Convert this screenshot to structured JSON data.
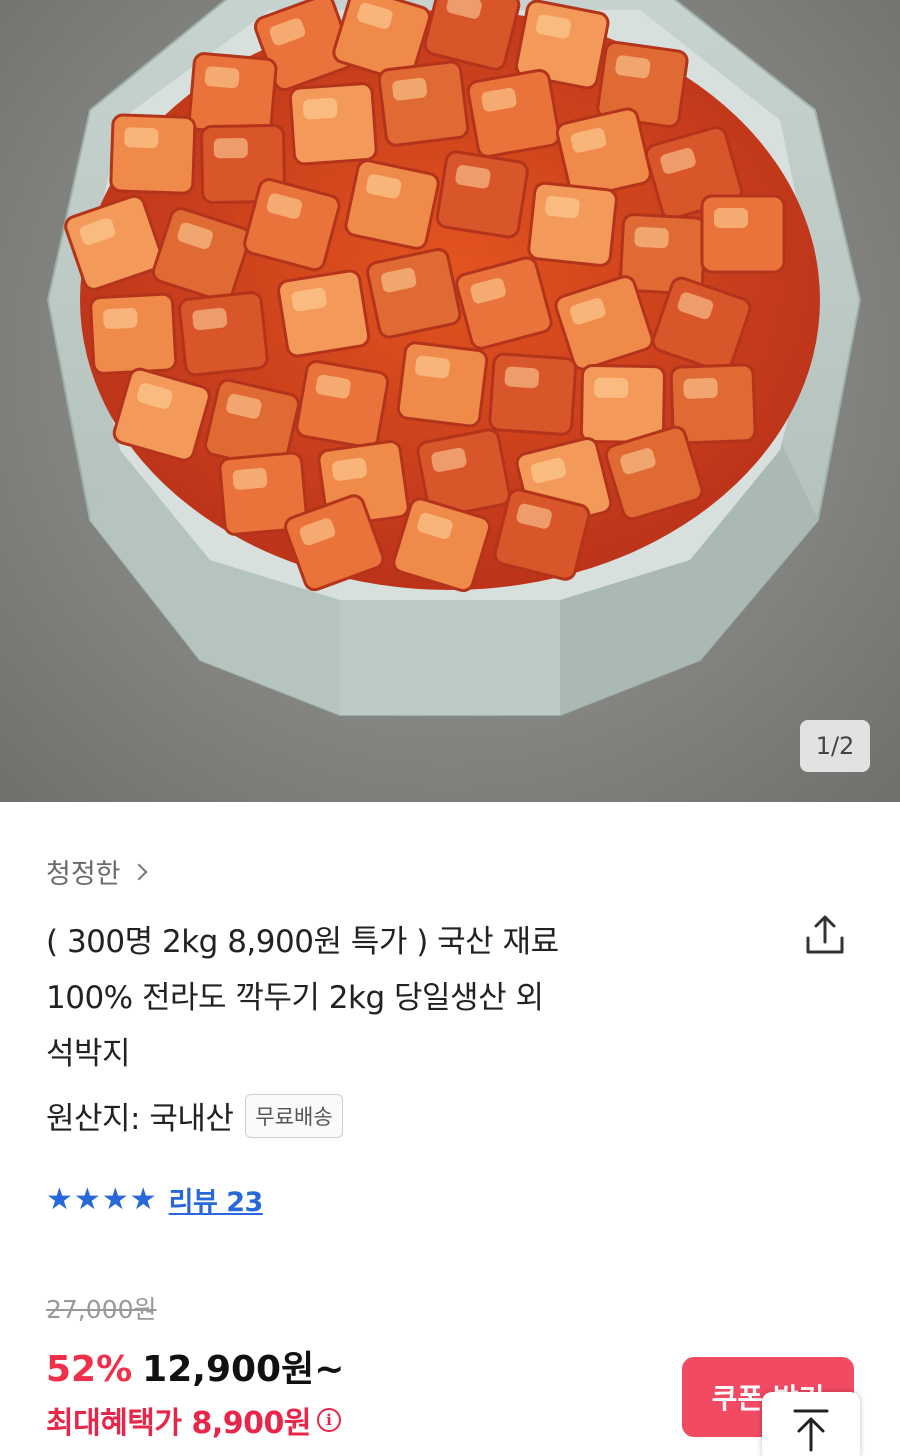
{
  "image": {
    "counter": "1/2"
  },
  "seller": {
    "name": "청정한"
  },
  "product": {
    "title_lines": [
      "( 300명 2kg 8,900원 특가 ) 국산 재료",
      "100% 전라도 깍두기 2kg 당일생산 외",
      "석박지"
    ],
    "origin": "원산지: 국내산",
    "shipping_badge": "무료배송"
  },
  "rating": {
    "stars": 4,
    "star_glyph": "★",
    "review_label": "리뷰 23"
  },
  "price": {
    "original": "27,000원",
    "discount": "52%",
    "sale": "12,900원~",
    "max_benefit": "최대혜택가 8,900원",
    "info_symbol": "i"
  },
  "buttons": {
    "coupon": "쿠폰 받기"
  },
  "colors": {
    "accent": "#f0304a",
    "link": "#2868d8",
    "coupon_bg": "#f24a63"
  },
  "icons": [
    "share-icon",
    "chevron-right-icon",
    "star-icon",
    "info-icon",
    "arrow-up-icon"
  ]
}
